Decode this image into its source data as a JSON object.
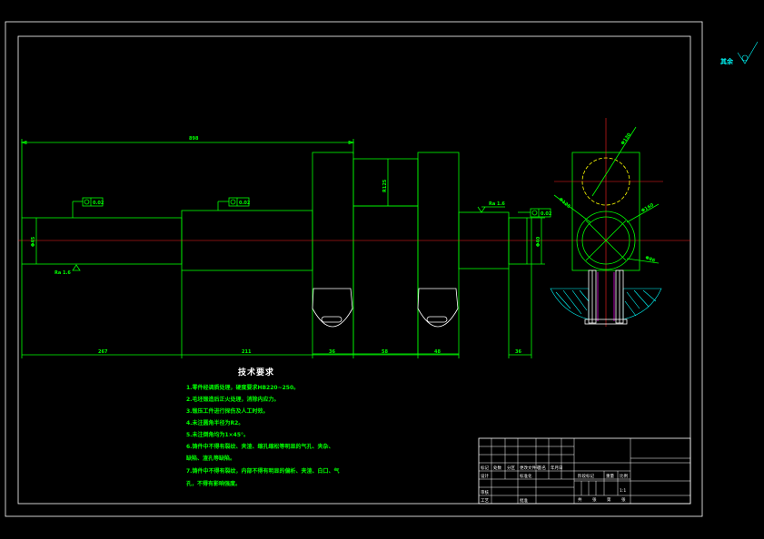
{
  "drawing": {
    "roughness_mark": "其余",
    "dimensions": {
      "overall_length": "898",
      "seg_1": "267",
      "seg_2": "211",
      "seg_3": "36",
      "seg_4": "58",
      "seg_5": "48",
      "seg_6": "36",
      "dia_left": "Φ45",
      "dia_right": "Φ40",
      "throw_offset": "R125",
      "circle_dia_1": "Φ130",
      "circle_dia_2": "Φ125",
      "circle_dia_3": "Φ160",
      "circle_dia_4": "Φ86",
      "gtol_1": "0.02",
      "gtol_2": "0.02",
      "gtol_3": "0.02",
      "ra_1": "Ra 1.6",
      "ra_2": "Ra 1.6"
    },
    "tech_notes": {
      "title": "技术要求",
      "lines": [
        "1.零件经调质处理，硬度要求HB220~250。",
        "2.毛坯锻造后正火处理，消除内应力。",
        "3.锻压工件进行探伤及人工时效。",
        "4.未注圆角半径为R2。",
        "5.未注倒角均为1×45°。",
        "6.铸件中不得有裂纹、夹渣、缩孔缩松等明显的气孔、夹杂、",
        "缺陷、渣孔等缺陷。",
        "7.铸件中不得有裂纹，内部不得有明显的偏析、夹渣、白口、气",
        "孔，不得有影响强度。"
      ]
    },
    "title_block": {
      "labels": [
        "标记",
        "处数",
        "分区",
        "更改文件号",
        "签名",
        "年月日",
        "设计",
        "标准化",
        "审核",
        "工艺",
        "批准",
        "阶段标记",
        "重量",
        "比例",
        "共",
        "张",
        "第",
        "张"
      ],
      "scale": "1:1"
    }
  }
}
